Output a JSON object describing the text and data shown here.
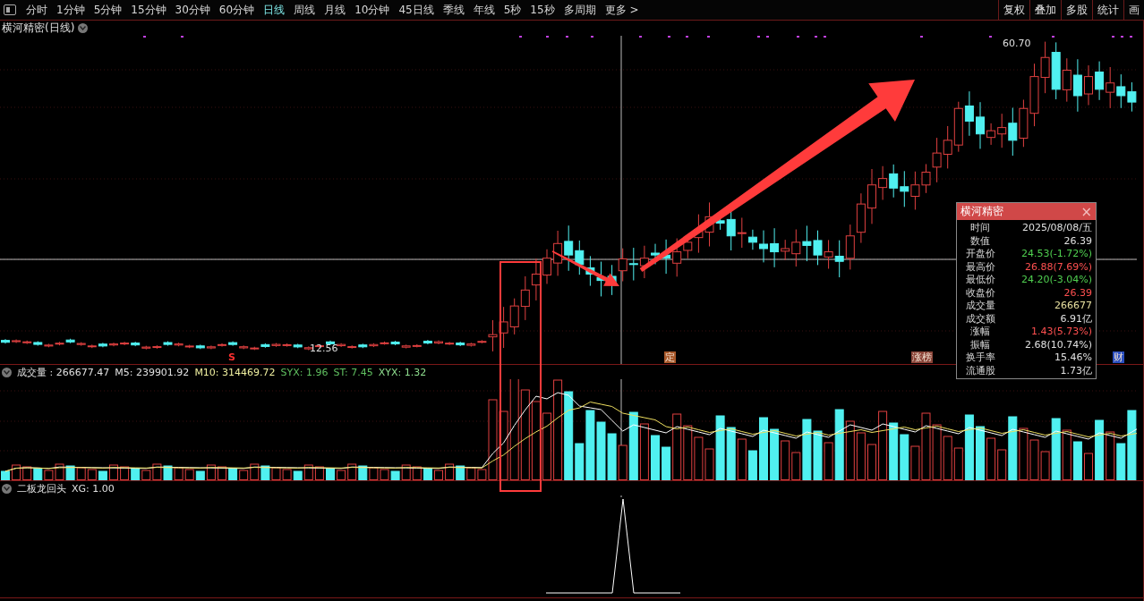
{
  "toolbar": {
    "periods": [
      {
        "label": "分时",
        "selected": false
      },
      {
        "label": "1分钟",
        "selected": false
      },
      {
        "label": "5分钟",
        "selected": false
      },
      {
        "label": "15分钟",
        "selected": false
      },
      {
        "label": "30分钟",
        "selected": false
      },
      {
        "label": "60分钟",
        "selected": false
      },
      {
        "label": "日线",
        "selected": true
      },
      {
        "label": "周线",
        "selected": false
      },
      {
        "label": "月线",
        "selected": false
      },
      {
        "label": "10分钟",
        "selected": false
      },
      {
        "label": "45日线",
        "selected": false
      },
      {
        "label": "季线",
        "selected": false
      },
      {
        "label": "年线",
        "selected": false
      },
      {
        "label": "5秒",
        "selected": false
      },
      {
        "label": "15秒",
        "selected": false
      },
      {
        "label": "多周期",
        "selected": false
      }
    ],
    "more": "更多 >",
    "tools": [
      "复权",
      "叠加",
      "多股",
      "统计",
      "画"
    ]
  },
  "main_chart": {
    "title": "横河精密(日线)",
    "high_label": "60.70",
    "low_label": "12.56",
    "markers": [
      {
        "label": "S",
        "kind": "text",
        "color": "#ff3030"
      },
      {
        "label": "定",
        "kind": "tag",
        "color": "#a8582a"
      },
      {
        "label": "涨榜",
        "kind": "tag",
        "color": "#8a4438"
      },
      {
        "label": "财",
        "kind": "tag",
        "color": "#2a4fc0"
      }
    ]
  },
  "info_panel": {
    "title": "横河精密",
    "close": "×",
    "rows": [
      {
        "label": "时间",
        "value": "2025/08/08/五",
        "color": "#e0e0e0"
      },
      {
        "label": "数值",
        "value": "26.39",
        "color": "#e0e0e0"
      },
      {
        "label": "开盘价",
        "value": "24.53(-1.72%)",
        "color": "#50d050"
      },
      {
        "label": "最高价",
        "value": "26.88(7.69%)",
        "color": "#ff5050"
      },
      {
        "label": "最低价",
        "value": "24.20(-3.04%)",
        "color": "#50d050"
      },
      {
        "label": "收盘价",
        "value": "26.39",
        "color": "#ff5050"
      },
      {
        "label": "成交量",
        "value": "266677",
        "color": "#e8e0a0"
      },
      {
        "label": "成交额",
        "value": "6.91亿",
        "color": "#e0e0e0"
      },
      {
        "label": "涨幅",
        "value": "1.43(5.73%)",
        "color": "#ff5050"
      },
      {
        "label": "振幅",
        "value": "2.68(10.74%)",
        "color": "#e0e0e0"
      },
      {
        "label": "换手率",
        "value": "15.46%",
        "color": "#e0e0e0"
      },
      {
        "label": "流通股",
        "value": "1.73亿",
        "color": "#e0e0e0"
      }
    ]
  },
  "volume_pane": {
    "legend": [
      {
        "text": "成交量 : 266677.47",
        "color": "#e0e0e0"
      },
      {
        "text": "M5: 239901.92",
        "color": "#e0e0e0"
      },
      {
        "text": "M10: 314469.72",
        "color": "#f0f0a0"
      },
      {
        "text": "SYX: 1.96",
        "color": "#60c060"
      },
      {
        "text": "ST: 7.45",
        "color": "#60c060"
      },
      {
        "text": "XYX: 1.32",
        "color": "#90e090"
      }
    ]
  },
  "indicator_pane": {
    "legend": [
      {
        "text": "二板龙回头"
      },
      {
        "text": "XG: 1.00"
      }
    ]
  }
}
